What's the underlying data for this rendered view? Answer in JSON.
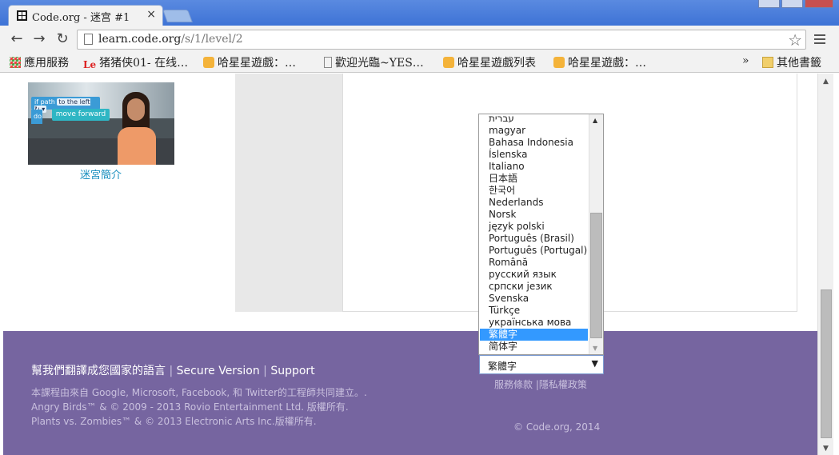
{
  "browser": {
    "tab_title": "Code.org - 迷宫 #1",
    "tab_close": "×",
    "url_host": "learn.code.org",
    "url_path": "/s/1/level/2",
    "bookmarks": [
      {
        "label": "應用服務",
        "icon": "apps-grid-icon"
      },
      {
        "label": "猪猪侠01- 在线…",
        "icon": "letv-icon"
      },
      {
        "label": "哈星星遊戲：…",
        "icon": "game-icon"
      },
      {
        "label": "歡迎光臨~YES…",
        "icon": "page-icon"
      },
      {
        "label": "哈星星遊戲列表",
        "icon": "game-icon"
      },
      {
        "label": "哈星星遊戲：…",
        "icon": "game-icon"
      }
    ],
    "bookmarks_overflow": "»",
    "other_bookmarks": "其他書籤"
  },
  "video": {
    "block_if": "if path",
    "block_chip": "to the left ↻ ▾",
    "block_do": "do",
    "block_move": "move forward",
    "caption": "迷宮簡介"
  },
  "footer": {
    "translate_link": "幫我們翻譯成您國家的語言",
    "secure_link": "Secure Version",
    "support_link": "Support",
    "separator": "|",
    "credit_line1": "本課程由來自 Google, Microsoft, Facebook, 和 Twitter的工程師共同建立。.",
    "credit_line2": "Angry Birds™ & © 2009 - 2013 Rovio Entertainment Ltd. 版權所有.",
    "credit_line3": "Plants vs. Zombies™ & © 2013 Electronic Arts Inc.版權所有.",
    "terms_link": "服務條款",
    "privacy_link": "隱私權政策",
    "copyright": "© Code.org, 2014"
  },
  "language_select": {
    "selected": "繁體字",
    "options": [
      "עברית",
      "magyar",
      "Bahasa Indonesia",
      "Íslenska",
      "Italiano",
      "日本語",
      "한국어",
      "Nederlands",
      "Norsk",
      "język polski",
      "Português (Brasil)",
      "Português (Portugal)",
      "Română",
      "русский язык",
      "српски језик",
      "Svenska",
      "Türkçe",
      "українська мова",
      "繁體字",
      "简体字"
    ],
    "highlighted_index": 18
  },
  "colors": {
    "footer_bg": "#7665a0",
    "highlight": "#3399ff",
    "link": "#1a8fbf"
  }
}
